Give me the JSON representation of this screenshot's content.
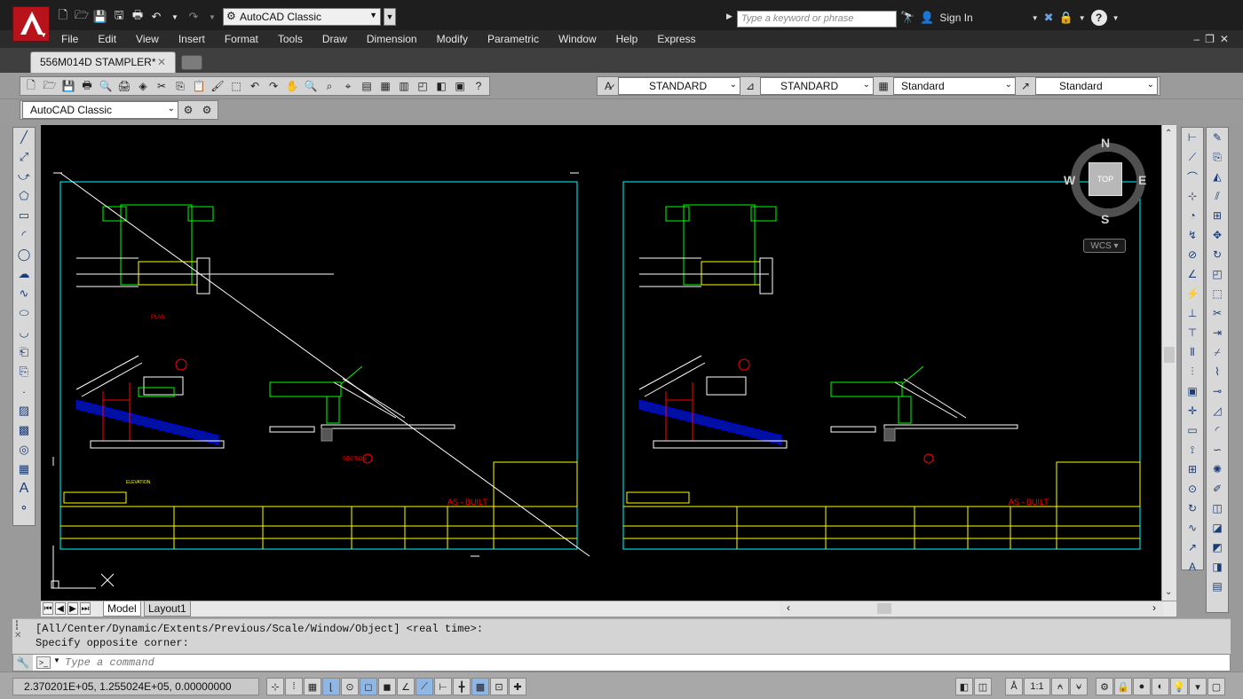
{
  "quick_access": {
    "workspace": "AutoCAD Classic"
  },
  "search": {
    "placeholder": "Type a keyword or phrase"
  },
  "account": {
    "sign_in_label": "Sign In"
  },
  "menu": [
    "File",
    "Edit",
    "View",
    "Insert",
    "Format",
    "Tools",
    "Draw",
    "Dimension",
    "Modify",
    "Parametric",
    "Window",
    "Help",
    "Express"
  ],
  "document_tab": {
    "title": "556M014D STAMPLER*"
  },
  "styles": {
    "text_style": "STANDARD",
    "dim_style": "STANDARD",
    "table_style": "Standard",
    "multileader_style": "Standard"
  },
  "workspace_toolbar": {
    "workspace": "AutoCAD Classic"
  },
  "viewcube": {
    "n": "N",
    "s": "S",
    "e": "E",
    "w": "W",
    "top": "TOP",
    "wcs": "WCS"
  },
  "drawing": {
    "sheet_stamp_left": "AS - BUILT",
    "sheet_stamp_right": "AS - BUILT",
    "section_label": "SECTION",
    "elevation_label": "ELEVATION",
    "plan_label": "PLAN"
  },
  "layout_tabs": {
    "model": "Model",
    "layout1": "Layout1"
  },
  "command": {
    "history": [
      "[All/Center/Dynamic/Extents/Previous/Scale/Window/Object] <real time>:",
      "Specify opposite corner:"
    ],
    "placeholder": "Type a command"
  },
  "status": {
    "coordinates": "2.370201E+05, 1.255024E+05, 0.00000000",
    "annotation_scale": "1:1"
  },
  "colors": {
    "app_red": "#b8121a",
    "canvas_bg": "#000000",
    "drawing_green": "#00ff00",
    "drawing_yellow": "#ffff00",
    "drawing_cyan": "#00ffff",
    "drawing_red": "#ff0000"
  }
}
